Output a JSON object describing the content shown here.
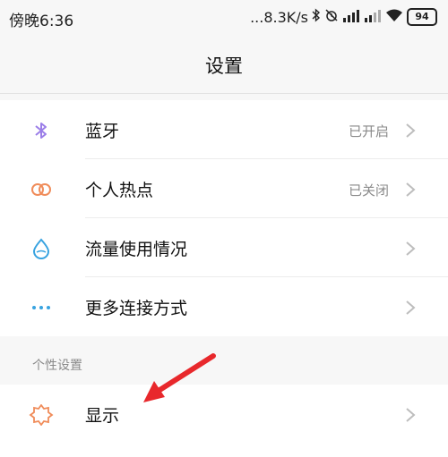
{
  "status_bar": {
    "time": "傍晚6:36",
    "speed": "...8.3K/s",
    "battery": "94"
  },
  "header": {
    "title": "设置"
  },
  "connectivity": [
    {
      "label": "蓝牙",
      "status": "已开启",
      "icon": "bluetooth-icon",
      "color": "#9b7ee8"
    },
    {
      "label": "个人热点",
      "status": "已关闭",
      "icon": "hotspot-icon",
      "color": "#f08c5a"
    },
    {
      "label": "流量使用情况",
      "status": "",
      "icon": "data-usage-icon",
      "color": "#38a3e0"
    },
    {
      "label": "更多连接方式",
      "status": "",
      "icon": "more-dots-icon",
      "color": "#38a3e0"
    }
  ],
  "personal_section": {
    "title": "个性设置",
    "items": [
      {
        "label": "显示",
        "icon": "display-sun-icon",
        "color": "#f08c5a"
      }
    ]
  },
  "annotation": {
    "arrow_color": "#e8282c"
  }
}
